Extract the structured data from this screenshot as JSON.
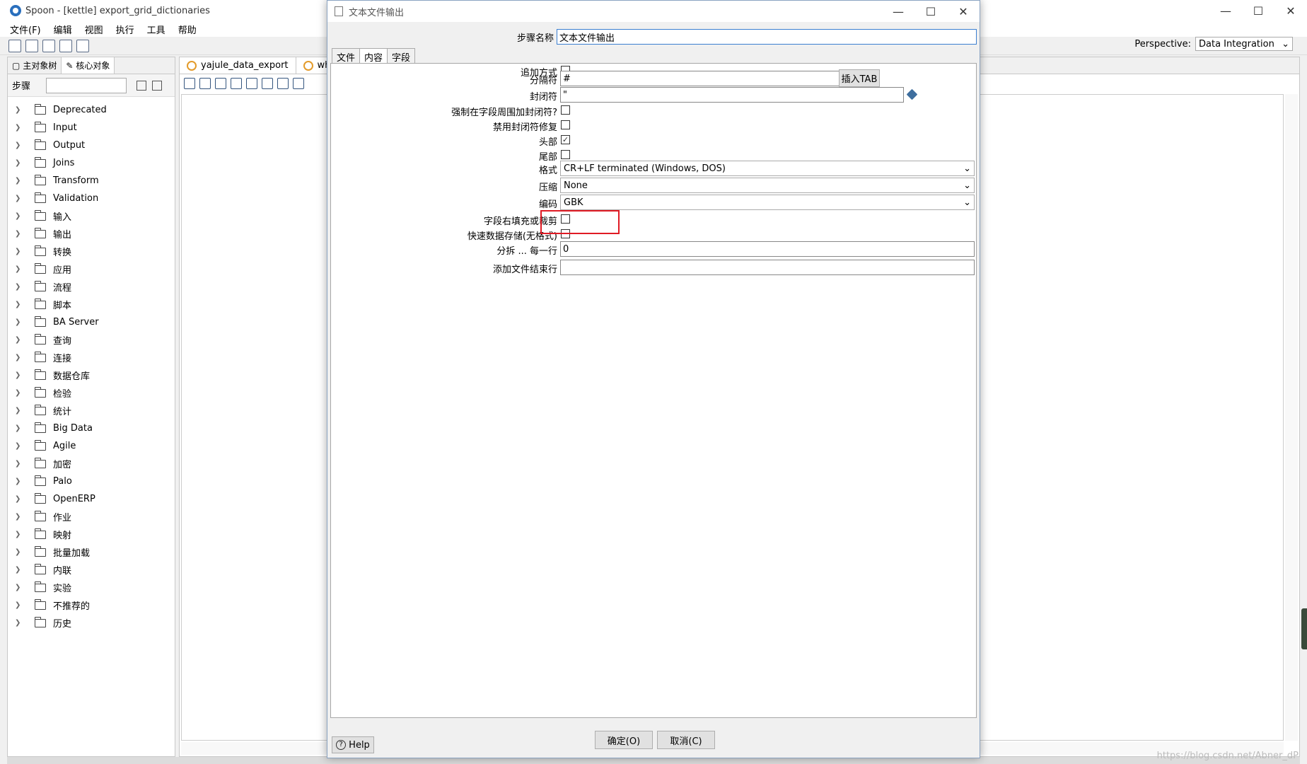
{
  "main_window": {
    "title": "Spoon - [kettle] export_grid_dictionaries",
    "menu": [
      "文件(F)",
      "编辑",
      "视图",
      "执行",
      "工具",
      "帮助"
    ],
    "perspective_label": "Perspective:",
    "perspective_value": "Data Integration"
  },
  "left_panel": {
    "tabs": [
      "主对象树",
      "核心对象"
    ],
    "search_label": "步骤",
    "tree": [
      "Deprecated",
      "Input",
      "Output",
      "Joins",
      "Transform",
      "Validation",
      "输入",
      "输出",
      "转换",
      "应用",
      "流程",
      "脚本",
      "BA Server",
      "查询",
      "连接",
      "数据仓库",
      "检验",
      "统计",
      "Big Data",
      "Agile",
      "加密",
      "Palo",
      "OpenERP",
      "作业",
      "映射",
      "批量加载",
      "内联",
      "实验",
      "不推荐的",
      "历史"
    ]
  },
  "center": {
    "tabs": [
      "yajule_data_export",
      "while"
    ]
  },
  "watermark": "https://blog.csdn.net/Abner_dP",
  "dialog": {
    "title": "文本文件输出",
    "step_name_label": "步骤名称",
    "step_name_value": "文本文件输出",
    "tabs": [
      "文件",
      "内容",
      "字段"
    ],
    "fields": {
      "append_label": "追加方式",
      "separator_label": "分隔符",
      "separator_value": "#",
      "insert_tab_label": "插入TAB",
      "enclosure_label": "封闭符",
      "enclosure_value": "\"",
      "force_enclosure_label": "强制在字段周围加封闭符?",
      "disable_enclosure_fix_label": "禁用封闭符修复",
      "header_label": "头部",
      "footer_label": "尾部",
      "format_label": "格式",
      "format_value": "CR+LF terminated (Windows, DOS)",
      "compression_label": "压缩",
      "compression_value": "None",
      "encoding_label": "编码",
      "encoding_value": "GBK",
      "pad_fields_label": "字段右填充或裁剪",
      "fast_dump_label": "快速数据存储(无格式)",
      "split_every_label": "分拆 ... 每一行",
      "split_every_value": "0",
      "end_line_label": "添加文件结束行",
      "end_line_value": ""
    },
    "checkboxes": {
      "append": false,
      "force_enclosure": false,
      "disable_enclosure_fix": false,
      "header": true,
      "footer": false,
      "pad_fields": false,
      "fast_dump": false
    },
    "help_label": "Help",
    "ok_label": "确定(O)",
    "cancel_label": "取消(C)"
  },
  "icons": {
    "app": "spoon-icon",
    "variable": "variable-diamond-icon",
    "help": "question-icon"
  }
}
